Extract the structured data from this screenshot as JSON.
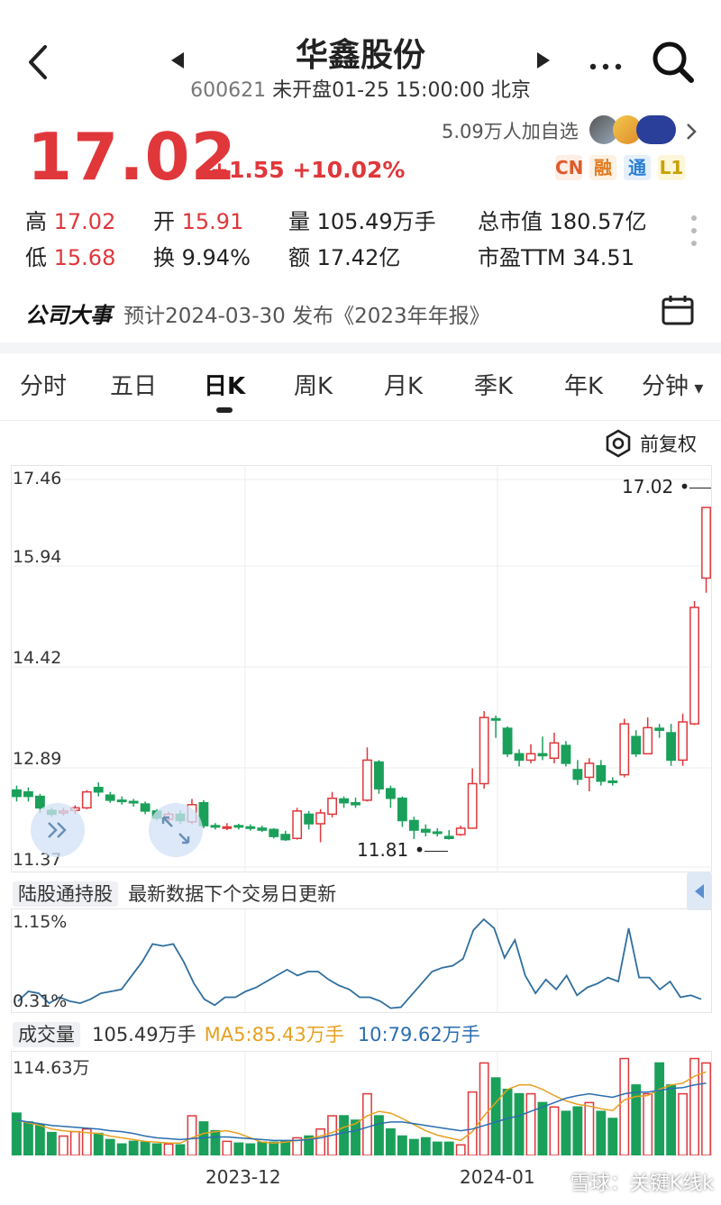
{
  "header": {
    "back_icon": "chevron-left-icon",
    "title": "华鑫股份",
    "code": "600621",
    "status": "未开盘01-25 15:00:00 北京",
    "more_icon": "more-dots-icon",
    "search_icon": "search-icon"
  },
  "quote": {
    "price": "17.02",
    "change": "+1.55",
    "change_pct": "+10.02%",
    "followers": "5.09万人加自选",
    "tags": [
      {
        "label": "CN",
        "color": "#e05a2a",
        "bg": "#fdeee6"
      },
      {
        "label": "融",
        "color": "#e07b20",
        "bg": "#fdf1e3"
      },
      {
        "label": "通",
        "color": "#2a7fd6",
        "bg": "#e6f0fb"
      },
      {
        "label": "L1",
        "color": "#c9a000",
        "bg": "#fdf6d9"
      }
    ],
    "stats": {
      "high_label": "高",
      "high": "17.02",
      "open_label": "开",
      "open": "15.91",
      "volume_label": "量",
      "volume": "105.49万手",
      "mcap_label": "总市值",
      "mcap": "180.57亿",
      "low_label": "低",
      "low": "15.68",
      "turnover_label": "换",
      "turnover": "9.94%",
      "amount_label": "额",
      "amount": "17.42亿",
      "pe_label": "市盈TTM",
      "pe": "34.51"
    }
  },
  "event": {
    "label": "公司大事",
    "text": "预计2024-03-30 发布《2023年年报》",
    "calendar_icon": "calendar-icon"
  },
  "tabs": [
    "分时",
    "五日",
    "日K",
    "周K",
    "月K",
    "季K",
    "年K",
    "分钟"
  ],
  "active_tab": "日K",
  "adjust": {
    "label": "前复权",
    "icon": "settings-hex-icon"
  },
  "kchart": {
    "y_labels": [
      "17.46",
      "15.94",
      "14.42",
      "12.89",
      "11.37"
    ],
    "max_label": "17.02",
    "min_label": "11.81",
    "colors": {
      "up": "#e0373b",
      "down": "#1aa05a"
    }
  },
  "hk": {
    "label": "陆股通持股",
    "note": "最新数据下个交易日更新",
    "top": "1.15%",
    "bottom": "0.31%"
  },
  "volume": {
    "label": "成交量",
    "value": "105.49万手",
    "ma5": "MA5:85.43万手",
    "ma10": "10:79.62万手",
    "max": "114.63万",
    "x_labels": [
      "2023-12",
      "2024-01"
    ]
  },
  "watermark": "雪球：关键K线k",
  "chart_data": {
    "type": "candlestick",
    "candles": [
      [
        12.58,
        12.48,
        12.65,
        12.4
      ],
      [
        12.55,
        12.48,
        12.62,
        12.4
      ],
      [
        12.48,
        12.3,
        12.52,
        12.22
      ],
      [
        12.26,
        12.2,
        12.3,
        12.16
      ],
      [
        12.22,
        12.25,
        12.3,
        12.18
      ],
      [
        12.26,
        12.3,
        12.34,
        12.2
      ],
      [
        12.3,
        12.55,
        12.58,
        12.28
      ],
      [
        12.62,
        12.55,
        12.7,
        12.48
      ],
      [
        12.5,
        12.42,
        12.55,
        12.38
      ],
      [
        12.42,
        12.4,
        12.48,
        12.35
      ],
      [
        12.4,
        12.38,
        12.44,
        12.32
      ],
      [
        12.36,
        12.25,
        12.4,
        12.2
      ],
      [
        12.25,
        12.14,
        12.28,
        12.1
      ],
      [
        12.12,
        12.2,
        12.24,
        12.06
      ],
      [
        12.2,
        12.1,
        12.26,
        12.05
      ],
      [
        12.08,
        12.35,
        12.44,
        12.04
      ],
      [
        12.38,
        12.02,
        12.42,
        11.98
      ],
      [
        12.02,
        12.0,
        12.06,
        11.96
      ],
      [
        12.0,
        12.0,
        12.06,
        11.95
      ],
      [
        12.02,
        12.0,
        12.05,
        11.96
      ],
      [
        12.0,
        11.98,
        12.04,
        11.94
      ],
      [
        11.98,
        11.95,
        12.02,
        11.92
      ],
      [
        11.96,
        11.85,
        11.98,
        11.82
      ],
      [
        11.88,
        11.8,
        11.94,
        11.78
      ],
      [
        11.82,
        12.25,
        12.3,
        11.8
      ],
      [
        12.2,
        12.05,
        12.25,
        11.96
      ],
      [
        12.05,
        12.22,
        12.28,
        11.76
      ],
      [
        12.2,
        12.45,
        12.55,
        12.15
      ],
      [
        12.44,
        12.38,
        12.48,
        12.3
      ],
      [
        12.38,
        12.35,
        12.46,
        12.3
      ],
      [
        12.42,
        13.05,
        13.25,
        12.4
      ],
      [
        13.02,
        12.6,
        13.05,
        12.52
      ],
      [
        12.6,
        12.45,
        12.65,
        12.3
      ],
      [
        12.45,
        12.1,
        12.48,
        12.0
      ],
      [
        12.1,
        11.95,
        12.16,
        11.81
      ],
      [
        11.96,
        11.92,
        12.04,
        11.85
      ],
      [
        11.92,
        11.9,
        11.98,
        11.85
      ],
      [
        11.85,
        11.82,
        11.95,
        11.8
      ],
      [
        11.88,
        11.98,
        12.02,
        11.86
      ],
      [
        11.98,
        12.68,
        12.92,
        11.98
      ],
      [
        12.68,
        13.72,
        13.82,
        12.6
      ],
      [
        13.7,
        13.68,
        13.75,
        13.4
      ],
      [
        13.55,
        13.15,
        13.58,
        13.1
      ],
      [
        13.15,
        13.05,
        13.22,
        12.95
      ],
      [
        13.05,
        13.15,
        13.3,
        13.0
      ],
      [
        13.15,
        13.12,
        13.42,
        13.05
      ],
      [
        13.08,
        13.32,
        13.48,
        13.0
      ],
      [
        13.28,
        13.0,
        13.35,
        12.95
      ],
      [
        12.9,
        12.75,
        13.05,
        12.66
      ],
      [
        12.78,
        13.0,
        13.08,
        12.56
      ],
      [
        12.96,
        12.72,
        13.05,
        12.65
      ],
      [
        12.72,
        12.7,
        12.78,
        12.65
      ],
      [
        12.82,
        13.62,
        13.7,
        12.78
      ],
      [
        13.42,
        13.15,
        13.52,
        13.1
      ],
      [
        13.15,
        13.56,
        13.72,
        13.15
      ],
      [
        13.55,
        13.52,
        13.62,
        13.4
      ],
      [
        13.48,
        13.05,
        13.62,
        12.96
      ],
      [
        13.05,
        13.65,
        13.78,
        12.96
      ],
      [
        13.62,
        15.45,
        15.55,
        13.6
      ],
      [
        15.91,
        17.02,
        17.02,
        15.68
      ]
    ],
    "hk_hold": [
      0.32,
      0.42,
      0.4,
      0.3,
      0.36,
      0.32,
      0.3,
      0.34,
      0.4,
      0.42,
      0.44,
      0.58,
      0.72,
      0.9,
      0.88,
      0.9,
      0.72,
      0.5,
      0.34,
      0.28,
      0.36,
      0.36,
      0.42,
      0.46,
      0.52,
      0.58,
      0.64,
      0.58,
      0.62,
      0.62,
      0.54,
      0.48,
      0.44,
      0.36,
      0.36,
      0.32,
      0.25,
      0.26,
      0.38,
      0.5,
      0.62,
      0.66,
      0.68,
      0.75,
      1.04,
      1.15,
      1.06,
      0.76,
      0.94,
      0.58,
      0.4,
      0.54,
      0.44,
      0.58,
      0.38,
      0.46,
      0.5,
      0.56,
      0.52,
      1.06,
      0.56,
      0.56,
      0.44,
      0.52,
      0.36,
      0.38,
      0.34
    ],
    "hk_range": [
      0.31,
      1.15
    ],
    "volumes": [
      48,
      38,
      35,
      26,
      22,
      27,
      30,
      25,
      18,
      13,
      16,
      15,
      13,
      13,
      12,
      45,
      38,
      28,
      16,
      14,
      13,
      15,
      15,
      16,
      20,
      22,
      30,
      45,
      45,
      40,
      70,
      45,
      30,
      22,
      18,
      20,
      15,
      15,
      12,
      72,
      105,
      88,
      75,
      70,
      70,
      60,
      55,
      50,
      55,
      60,
      50,
      42,
      110,
      80,
      70,
      105,
      80,
      70,
      110,
      105
    ],
    "ma5": [
      40,
      37,
      34,
      30,
      28,
      27,
      26,
      25,
      22,
      20,
      18,
      16,
      15,
      14,
      14,
      20,
      25,
      27,
      28,
      25,
      20,
      15,
      14,
      15,
      17,
      19,
      22,
      26,
      32,
      36,
      45,
      50,
      48,
      42,
      35,
      28,
      23,
      20,
      17,
      27,
      45,
      60,
      75,
      80,
      80,
      75,
      68,
      62,
      58,
      56,
      53,
      51,
      63,
      67,
      68,
      75,
      80,
      82,
      90,
      95
    ],
    "ma10": [
      40,
      38,
      36,
      34,
      33,
      32,
      31,
      30,
      28,
      27,
      25,
      22,
      20,
      19,
      18,
      19,
      20,
      21,
      21,
      20,
      19,
      18,
      17,
      17,
      17,
      18,
      20,
      23,
      26,
      28,
      32,
      36,
      38,
      38,
      36,
      34,
      32,
      30,
      28,
      30,
      34,
      38,
      42,
      45,
      50,
      55,
      60,
      65,
      68,
      70,
      68,
      66,
      70,
      72,
      72,
      74,
      76,
      77,
      80,
      82
    ],
    "volume_max": 114.63
  }
}
